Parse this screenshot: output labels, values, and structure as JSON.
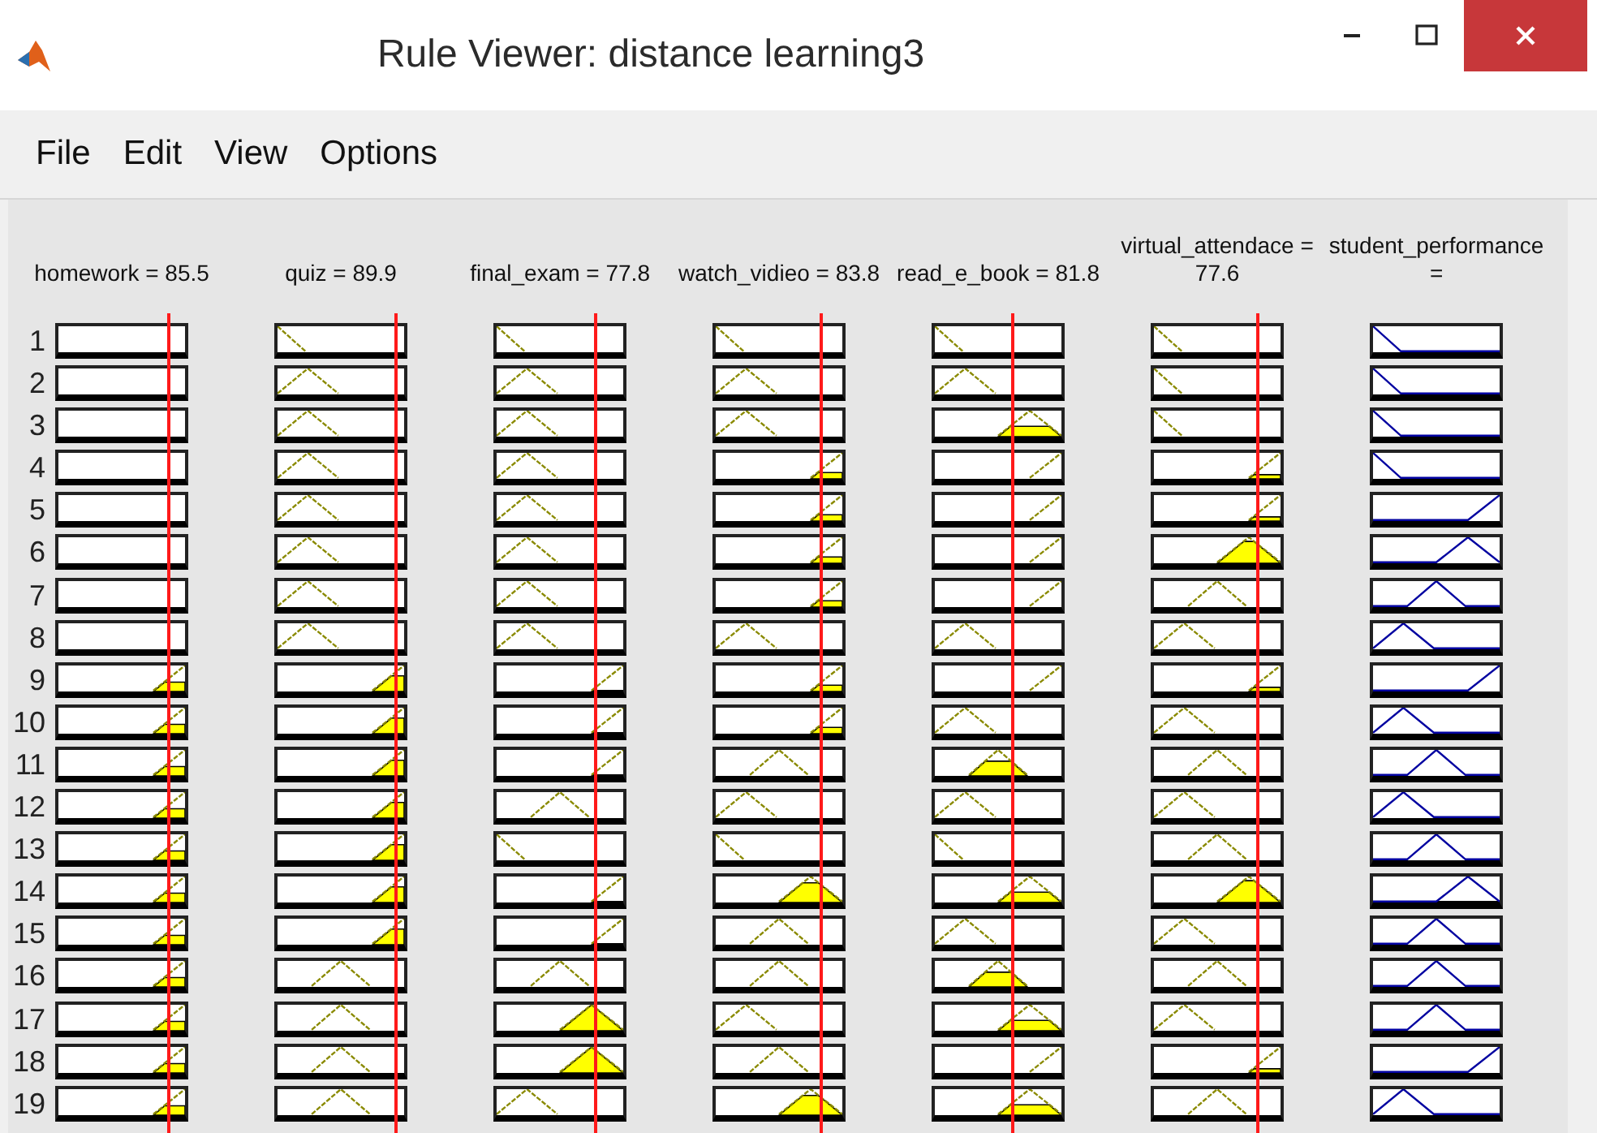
{
  "window": {
    "title": "Rule Viewer: distance learning3"
  },
  "menu": [
    "File",
    "Edit",
    "View",
    "Options"
  ],
  "variables": [
    {
      "label": "homework = 85.5",
      "kind": "input",
      "level": 0.84
    },
    {
      "label": "quiz = 89.9",
      "kind": "input",
      "level": 0.9
    },
    {
      "label": "final_exam = 77.8",
      "kind": "input",
      "level": 0.76
    },
    {
      "label": "watch_vidieo = 83.8",
      "kind": "input",
      "level": 0.81
    },
    {
      "label": "read_e_book = 81.8",
      "kind": "input",
      "level": 0.6
    },
    {
      "label": "virtual_attendace = 77.6",
      "kind": "input",
      "level": 0.79
    },
    {
      "label": "student_performance =",
      "kind": "output"
    }
  ],
  "rules": [
    {
      "number": "1",
      "cells": [
        {
          "kind": "none"
        },
        {
          "kind": "low"
        },
        {
          "kind": "low"
        },
        {
          "kind": "low"
        },
        {
          "kind": "low"
        },
        {
          "kind": "low"
        },
        {
          "kind": "low"
        }
      ]
    },
    {
      "number": "2",
      "cells": [
        {
          "kind": "none"
        },
        {
          "kind": "lowmid"
        },
        {
          "kind": "lowmid"
        },
        {
          "kind": "lowmid"
        },
        {
          "kind": "lowmid"
        },
        {
          "kind": "low"
        },
        {
          "kind": "low"
        }
      ]
    },
    {
      "number": "3",
      "cells": [
        {
          "kind": "none"
        },
        {
          "kind": "lowmid"
        },
        {
          "kind": "lowmid"
        },
        {
          "kind": "lowmid"
        },
        {
          "kind": "highmid"
        },
        {
          "kind": "low"
        },
        {
          "kind": "low"
        }
      ]
    },
    {
      "number": "4",
      "cells": [
        {
          "kind": "none"
        },
        {
          "kind": "lowmid"
        },
        {
          "kind": "lowmid"
        },
        {
          "kind": "high"
        },
        {
          "kind": "high"
        },
        {
          "kind": "high"
        },
        {
          "kind": "low"
        }
      ]
    },
    {
      "number": "5",
      "cells": [
        {
          "kind": "none"
        },
        {
          "kind": "lowmid"
        },
        {
          "kind": "lowmid"
        },
        {
          "kind": "high"
        },
        {
          "kind": "high"
        },
        {
          "kind": "high"
        },
        {
          "kind": "high"
        }
      ]
    },
    {
      "number": "6",
      "cells": [
        {
          "kind": "none"
        },
        {
          "kind": "lowmid"
        },
        {
          "kind": "lowmid"
        },
        {
          "kind": "high"
        },
        {
          "kind": "high"
        },
        {
          "kind": "highmid"
        },
        {
          "kind": "highmid"
        }
      ]
    },
    {
      "number": "7",
      "cells": [
        {
          "kind": "none"
        },
        {
          "kind": "lowmid"
        },
        {
          "kind": "lowmid"
        },
        {
          "kind": "high"
        },
        {
          "kind": "high"
        },
        {
          "kind": "mid"
        },
        {
          "kind": "mid"
        }
      ]
    },
    {
      "number": "8",
      "cells": [
        {
          "kind": "none"
        },
        {
          "kind": "lowmid"
        },
        {
          "kind": "lowmid"
        },
        {
          "kind": "lowmid"
        },
        {
          "kind": "lowmid"
        },
        {
          "kind": "lowmid"
        },
        {
          "kind": "lowmid"
        }
      ]
    },
    {
      "number": "9",
      "cells": [
        {
          "kind": "high"
        },
        {
          "kind": "high"
        },
        {
          "kind": "high"
        },
        {
          "kind": "high"
        },
        {
          "kind": "high"
        },
        {
          "kind": "high"
        },
        {
          "kind": "high"
        }
      ]
    },
    {
      "number": "10",
      "cells": [
        {
          "kind": "high"
        },
        {
          "kind": "high"
        },
        {
          "kind": "high"
        },
        {
          "kind": "high"
        },
        {
          "kind": "lowmid"
        },
        {
          "kind": "lowmid"
        },
        {
          "kind": "lowmid"
        }
      ]
    },
    {
      "number": "11",
      "cells": [
        {
          "kind": "high"
        },
        {
          "kind": "high"
        },
        {
          "kind": "high"
        },
        {
          "kind": "mid"
        },
        {
          "kind": "mid"
        },
        {
          "kind": "mid"
        },
        {
          "kind": "mid"
        }
      ]
    },
    {
      "number": "12",
      "cells": [
        {
          "kind": "high"
        },
        {
          "kind": "high"
        },
        {
          "kind": "mid"
        },
        {
          "kind": "lowmid"
        },
        {
          "kind": "lowmid"
        },
        {
          "kind": "lowmid"
        },
        {
          "kind": "lowmid"
        }
      ]
    },
    {
      "number": "13",
      "cells": [
        {
          "kind": "high"
        },
        {
          "kind": "high"
        },
        {
          "kind": "low"
        },
        {
          "kind": "low"
        },
        {
          "kind": "low"
        },
        {
          "kind": "mid"
        },
        {
          "kind": "mid"
        }
      ]
    },
    {
      "number": "14",
      "cells": [
        {
          "kind": "high"
        },
        {
          "kind": "high"
        },
        {
          "kind": "high"
        },
        {
          "kind": "highmid"
        },
        {
          "kind": "highmid"
        },
        {
          "kind": "highmid"
        },
        {
          "kind": "highmid"
        }
      ]
    },
    {
      "number": "15",
      "cells": [
        {
          "kind": "high"
        },
        {
          "kind": "high"
        },
        {
          "kind": "high"
        },
        {
          "kind": "mid"
        },
        {
          "kind": "lowmid"
        },
        {
          "kind": "lowmid"
        },
        {
          "kind": "mid"
        }
      ]
    },
    {
      "number": "16",
      "cells": [
        {
          "kind": "high"
        },
        {
          "kind": "mid"
        },
        {
          "kind": "mid"
        },
        {
          "kind": "mid"
        },
        {
          "kind": "mid"
        },
        {
          "kind": "mid"
        },
        {
          "kind": "mid"
        }
      ]
    },
    {
      "number": "17",
      "cells": [
        {
          "kind": "high"
        },
        {
          "kind": "mid"
        },
        {
          "kind": "highmid"
        },
        {
          "kind": "lowmid"
        },
        {
          "kind": "highmid"
        },
        {
          "kind": "lowmid"
        },
        {
          "kind": "mid"
        }
      ]
    },
    {
      "number": "18",
      "cells": [
        {
          "kind": "high"
        },
        {
          "kind": "mid"
        },
        {
          "kind": "highmid"
        },
        {
          "kind": "mid"
        },
        {
          "kind": "high"
        },
        {
          "kind": "high"
        },
        {
          "kind": "high"
        }
      ]
    },
    {
      "number": "19",
      "cells": [
        {
          "kind": "high"
        },
        {
          "kind": "mid"
        },
        {
          "kind": "lowmid"
        },
        {
          "kind": "highmid"
        },
        {
          "kind": "highmid"
        },
        {
          "kind": "mid"
        },
        {
          "kind": "lowmid"
        }
      ]
    }
  ]
}
